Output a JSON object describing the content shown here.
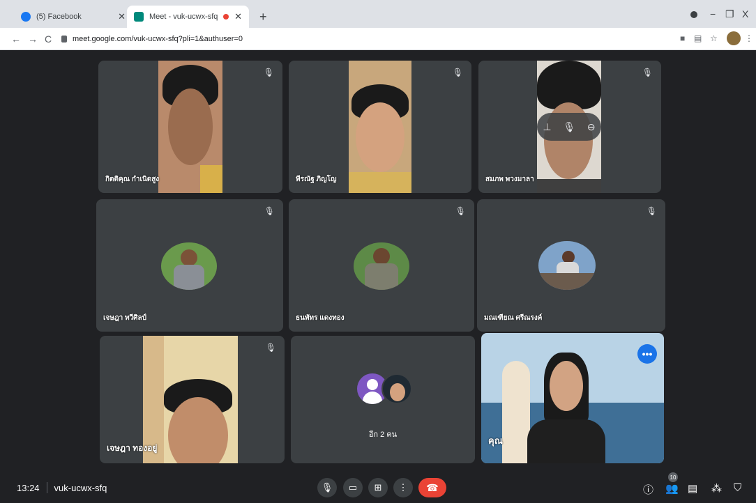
{
  "browser": {
    "tabs": [
      {
        "title": "(5) Facebook",
        "favicon_color": "#1877f2"
      },
      {
        "title": "Meet - vuk-ucwx-sfq",
        "favicon_color": "#00897b"
      }
    ],
    "url": "meet.google.com/vuk-ucwx-sfq?pli=1&authuser=0",
    "window_controls": {
      "minimize": "−",
      "restore": "❐",
      "close": "X"
    }
  },
  "participants": [
    {
      "name": "กิตติคุณ กำเนิดสูง",
      "mic_muted": true
    },
    {
      "name": "พีรณัฐ ภิญโญ",
      "mic_muted": true
    },
    {
      "name": "สมภพ พวงมาลา",
      "mic_muted": true
    },
    {
      "name": "เจษฎา ทวีศิลป์",
      "mic_muted": true
    },
    {
      "name": "ธนพัทร แดงทอง",
      "mic_muted": true
    },
    {
      "name": "มณเฑียณ ศรีณรงค์",
      "mic_muted": true
    },
    {
      "name": "เจษฎา ทองอยู่",
      "mic_muted": true
    },
    {
      "name": "อีก 2 คน"
    },
    {
      "name": "คุณ"
    }
  ],
  "bottom_bar": {
    "time": "13:24",
    "meeting_code": "vuk-ucwx-sfq",
    "participant_count": "10"
  },
  "colors": {
    "background": "#202124",
    "tile": "#3c4043",
    "hangup": "#ea4335",
    "accent": "#1a73e8"
  }
}
